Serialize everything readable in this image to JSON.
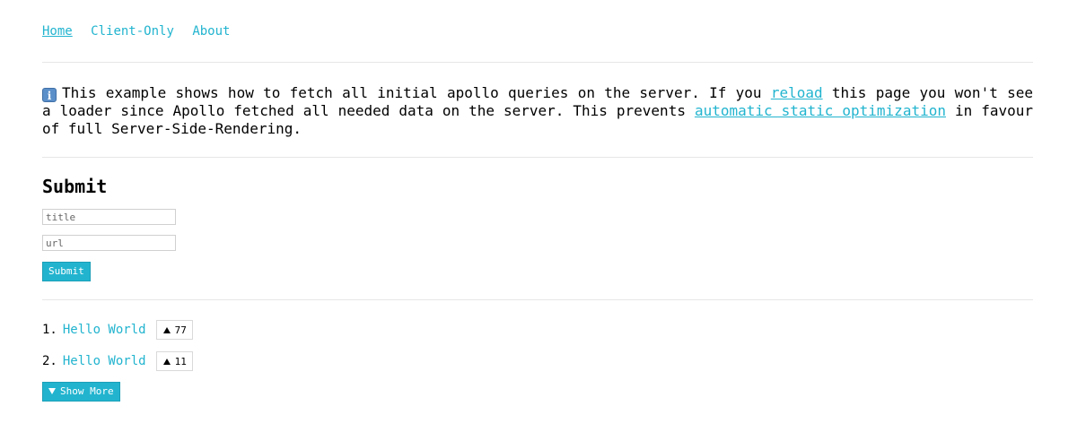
{
  "nav": {
    "items": [
      {
        "label": "Home",
        "active": true
      },
      {
        "label": "Client-Only",
        "active": false
      },
      {
        "label": "About",
        "active": false
      }
    ]
  },
  "info": {
    "icon": "info-icon",
    "icon_glyph": "i",
    "text_before_reload": "This example shows how to fetch all initial apollo queries on the server. If you ",
    "reload_link": "reload",
    "text_after_reload": " this page you won't see a loader since Apollo fetched all needed data on the server. This prevents ",
    "optimization_link": "automatic static optimization",
    "text_end": " in favour of full Server-Side-Rendering."
  },
  "submit_form": {
    "title": "Submit",
    "title_placeholder": "title",
    "url_placeholder": "url",
    "button_label": "Submit"
  },
  "posts": [
    {
      "index": "1.",
      "title": "Hello World",
      "votes": "77"
    },
    {
      "index": "2.",
      "title": "Hello World",
      "votes": "11"
    }
  ],
  "show_more": {
    "label": "Show More",
    "icon": "triangle-down-icon"
  },
  "colors": {
    "accent": "#22b4cf",
    "divider": "#e6e6e6"
  }
}
